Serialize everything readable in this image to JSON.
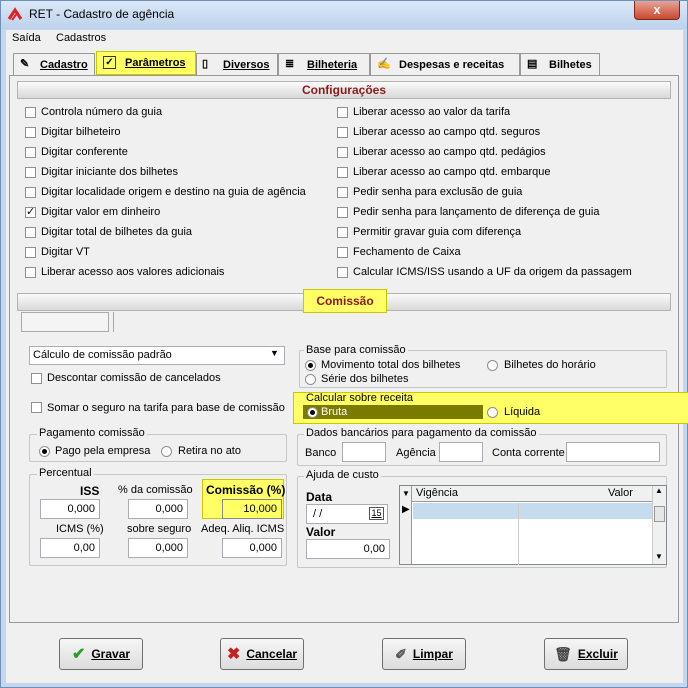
{
  "window": {
    "title": "RET - Cadastro de agência",
    "close_label": "x"
  },
  "menu": [
    "Saída",
    "Cadastros"
  ],
  "tabs": [
    {
      "label": "Cadastro"
    },
    {
      "label": "Parâmetros"
    },
    {
      "label": "Diversos"
    },
    {
      "label": "Bilheteria"
    },
    {
      "label": "Despesas e receitas"
    },
    {
      "label": "Bilhetes"
    }
  ],
  "config": {
    "title": "Configurações",
    "left": [
      {
        "label": "Controla número da guia",
        "checked": false
      },
      {
        "label": "Digitar bilheteiro",
        "checked": false
      },
      {
        "label": "Digitar conferente",
        "checked": false
      },
      {
        "label": "Digitar iniciante dos bilhetes",
        "checked": false
      },
      {
        "label": "Digitar localidade origem e destino na guia de agência",
        "checked": false
      },
      {
        "label": "Digitar valor em dinheiro",
        "checked": true
      },
      {
        "label": "Digitar total de bilhetes da guia",
        "checked": false
      },
      {
        "label": "Digitar VT",
        "checked": false
      },
      {
        "label": "Liberar acesso aos valores adicionais",
        "checked": false
      }
    ],
    "right": [
      {
        "label": "Liberar acesso ao valor da tarifa",
        "checked": false
      },
      {
        "label": "Liberar acesso ao campo qtd. seguros",
        "checked": false
      },
      {
        "label": "Liberar acesso ao campo qtd. pedágios",
        "checked": false
      },
      {
        "label": "Liberar acesso ao campo qtd. embarque",
        "checked": false
      },
      {
        "label": "Pedir senha para exclusão de guia",
        "checked": false
      },
      {
        "label": "Pedir senha para lançamento de diferença de guia",
        "checked": false
      },
      {
        "label": "Permitir gravar guia com diferença",
        "checked": false
      },
      {
        "label": "Fechamento de Caixa",
        "checked": false
      },
      {
        "label": "Calcular ICMS/ISS usando a UF da origem da passagem",
        "checked": false
      }
    ]
  },
  "comissao": {
    "title": "Comissão",
    "calc_select": "Cálculo de comissão padrão",
    "descontar": "Descontar comissão de cancelados",
    "somar": "Somar o seguro na tarifa para base de comissão",
    "base": {
      "title": "Base para comissão",
      "opt1": "Movimento total dos bilhetes",
      "opt2": "Bilhetes do horário",
      "opt3": "Série dos bilhetes"
    },
    "calcular": {
      "title": "Calcular sobre receita",
      "opt1": "Bruta",
      "opt2": "Líquida"
    },
    "pagamento": {
      "title": "Pagamento comissão",
      "opt1": "Pago pela empresa",
      "opt2": "Retira no ato"
    },
    "dados": {
      "title": "Dados bancários para pagamento da comissão",
      "banco": "Banco",
      "agencia": "Agência",
      "conta": "Conta corrente"
    },
    "percentual": {
      "title": "Percentual",
      "iss_label": "ISS",
      "iss": "0,000",
      "pct_label": "% da comissão",
      "pct": "0,000",
      "com_label": "Comissão (%)",
      "com": "10,000",
      "icms_label": "ICMS (%)",
      "icms": "0,00",
      "seguro_label": "sobre seguro",
      "seguro": "0,000",
      "adeq_label": "Adeq. Aliq. ICMS",
      "adeq": "0,000"
    },
    "ajuda": {
      "title": "Ajuda de custo",
      "data_label": "Data",
      "data": "/ /",
      "cal": "15",
      "valor_label": "Valor",
      "valor": "0,00",
      "col1": "Vigência",
      "col2": "Valor"
    }
  },
  "buttons": {
    "gravar": "Gravar",
    "cancelar": "Cancelar",
    "limpar": "Limpar",
    "excluir": "Excluir"
  },
  "colors": {
    "highlight": "#ffff66",
    "section_title": "#8b1a1a",
    "selected_radio_bg": "#7a7a00"
  }
}
